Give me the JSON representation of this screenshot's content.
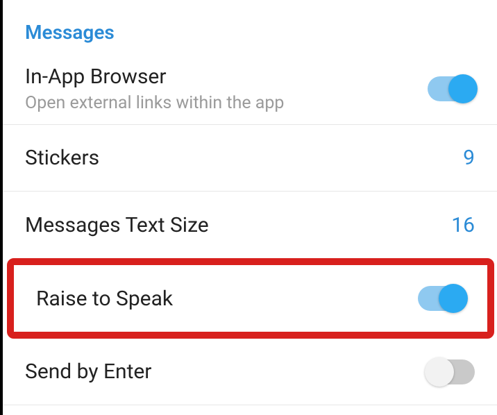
{
  "section": {
    "header": "Messages",
    "items": [
      {
        "title": "In-App Browser",
        "subtitle": "Open external links within the app",
        "toggle_on": true
      },
      {
        "title": "Stickers",
        "value": "9"
      },
      {
        "title": "Messages Text Size",
        "value": "16"
      },
      {
        "title": "Raise to Speak",
        "toggle_on": true
      },
      {
        "title": "Send by Enter",
        "toggle_on": false
      }
    ]
  }
}
